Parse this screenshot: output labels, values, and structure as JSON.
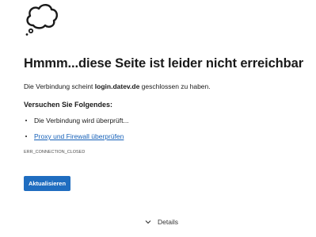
{
  "error_page": {
    "illustration_icon": "thought-cloud-icon",
    "title": "Hmmm...diese Seite ist leider nicht erreichbar",
    "description_before": "Die Verbindung scheint ",
    "host": "login.datev.de",
    "description_after": " geschlossen zu haben.",
    "suggestions_heading": "Versuchen Sie Folgendes:",
    "suggestions": [
      {
        "label": "Die Verbindung wird überprüft..."
      },
      {
        "label": "Proxy und Firewall überprüfen"
      }
    ],
    "error_code": "ERR_CONNECTION_CLOSED",
    "reload_button": "Aktualisieren",
    "details_toggle": "Details",
    "details_icon": "chevron-down-icon",
    "colors": {
      "button_bg": "#1f6dc0",
      "link": "#1560b8",
      "text": "#1a1a1a"
    }
  }
}
